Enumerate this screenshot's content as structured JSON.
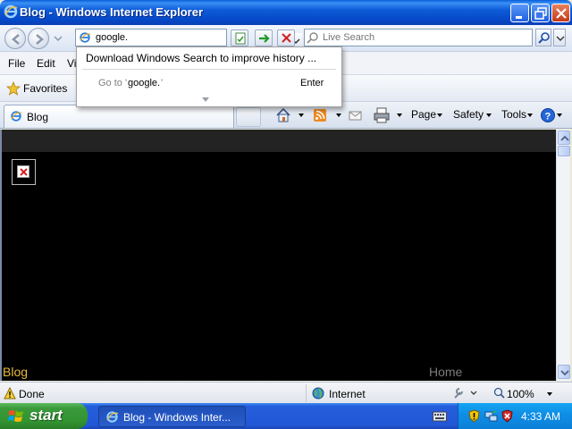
{
  "window": {
    "title": "Blog - Windows Internet Explorer"
  },
  "address_bar": {
    "value": "google.",
    "search_placeholder": "Live Search"
  },
  "menu": {
    "items": [
      "File",
      "Edit",
      "Vi"
    ]
  },
  "favorites": {
    "label": "Favorites"
  },
  "tabs": [
    {
      "label": "Blog"
    }
  ],
  "command_bar": {
    "page": "Page",
    "safety": "Safety",
    "tools": "Tools"
  },
  "address_popup": {
    "download_text": "Download Windows Search to improve history ...",
    "goto_prefix": "Go to '",
    "goto_value": "google.",
    "goto_suffix": "'",
    "enter_label": "Enter"
  },
  "page": {
    "footer_left": "Blog",
    "footer_right": "Home"
  },
  "status": {
    "text": "Done",
    "zone": "Internet",
    "zoom": "100%"
  },
  "taskbar": {
    "start": "start",
    "task_label": "Blog - Windows Inter...",
    "clock": "4:33 AM"
  },
  "colors": {
    "title_bar": "#0648c8",
    "footer_link": "#e7b93e",
    "content_bg": "#000000",
    "start_green": "#3b9a3b"
  }
}
